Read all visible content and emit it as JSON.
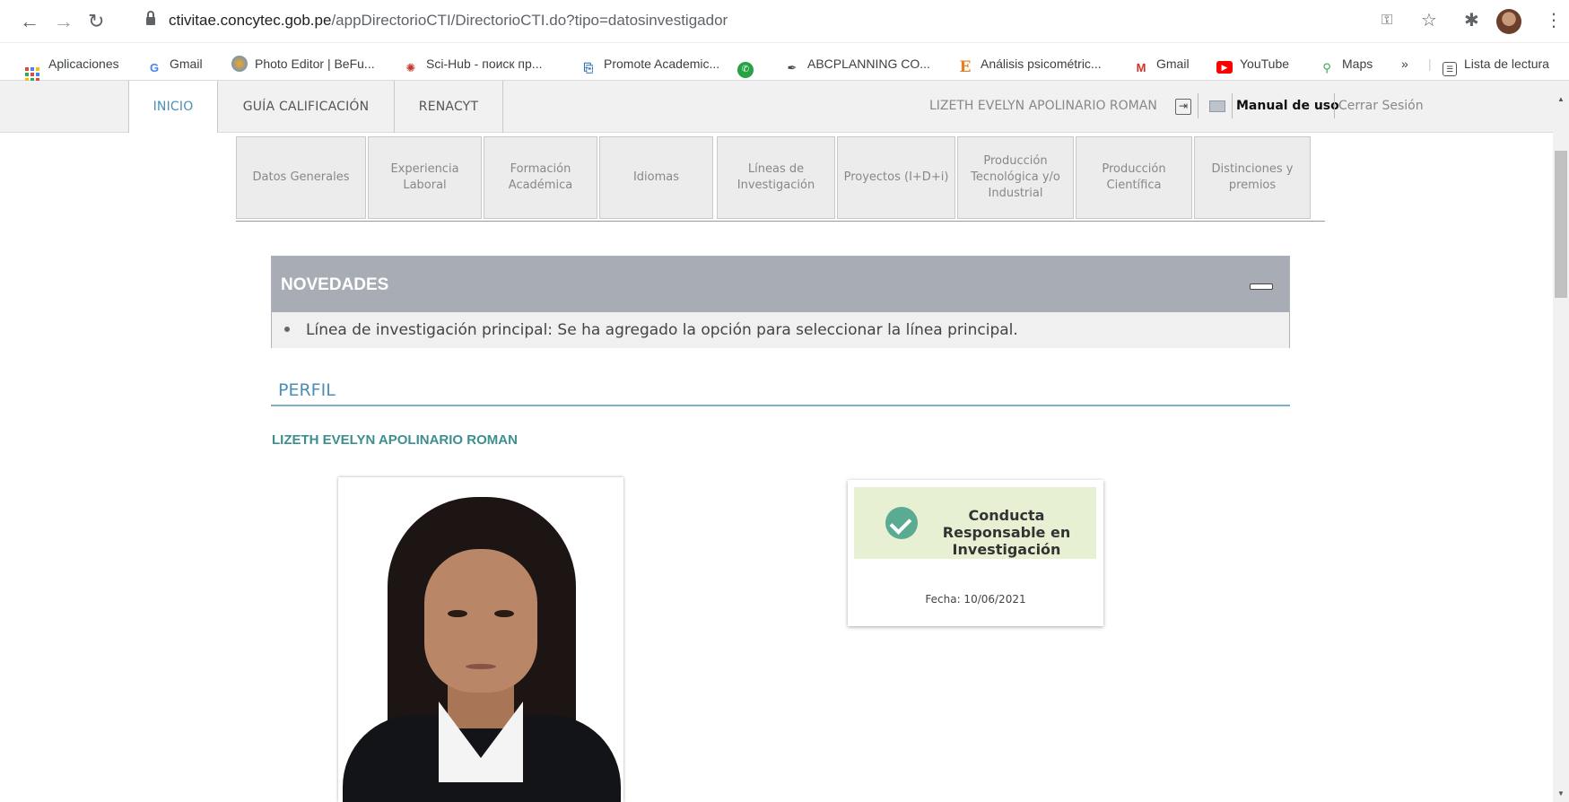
{
  "browser": {
    "url_domain": "ctivitae.concytec.gob.pe",
    "url_path": "/appDirectorioCTI/DirectorioCTI.do?tipo=datosinvestigador",
    "bookmarks": [
      {
        "label": "Aplicaciones",
        "icon": "apps-icon"
      },
      {
        "label": "Gmail",
        "icon": "google-icon"
      },
      {
        "label": "Photo Editor | BeFu...",
        "icon": "befunky-icon"
      },
      {
        "label": "Sci-Hub - поиск пр...",
        "icon": "scihub-icon"
      },
      {
        "label": "Promote Academic...",
        "icon": "document-icon"
      },
      {
        "label": "",
        "icon": "whatsapp-icon"
      },
      {
        "label": "ABCPLANNING CO...",
        "icon": "feather-icon"
      },
      {
        "label": "Análisis psicométric...",
        "icon": "e-icon"
      },
      {
        "label": "Gmail",
        "icon": "gmail-icon"
      },
      {
        "label": "YouTube",
        "icon": "youtube-icon"
      },
      {
        "label": "Maps",
        "icon": "maps-icon"
      },
      {
        "label": "»",
        "icon": ""
      },
      {
        "label": "Lista de lectura",
        "icon": "reading-list-icon"
      }
    ]
  },
  "topnav": {
    "tabs": [
      "INICIO",
      "GUÍA CALIFICACIÓN",
      "RENACYT"
    ],
    "user_name": "LIZETH EVELYN APOLINARIO ROMAN",
    "manual": "Manual de uso",
    "logout": "Cerrar Sesión"
  },
  "subtabs": [
    "Datos Generales",
    "Experiencia Laboral",
    "Formación Académica",
    "Idiomas",
    "Líneas de Investigación",
    "Proyectos (I+D+i)",
    "Producción Tecnológica y/o Industrial",
    "Producción Científica",
    "Distinciones y premios"
  ],
  "novedades": {
    "title": "NOVEDADES",
    "item": "Línea de investigación principal: Se ha agregado la opción para seleccionar la línea principal."
  },
  "perfil": {
    "heading": "PERFIL",
    "name": "LIZETH EVELYN APOLINARIO ROMAN"
  },
  "badge": {
    "title": "Conducta Responsable en Investigación",
    "date": "Fecha: 10/06/2021"
  },
  "colors": {
    "accent": "#4a8fb5",
    "name_color": "#3d8f8f",
    "badge_bg": "#e8f0d4",
    "check": "#5aab92"
  }
}
